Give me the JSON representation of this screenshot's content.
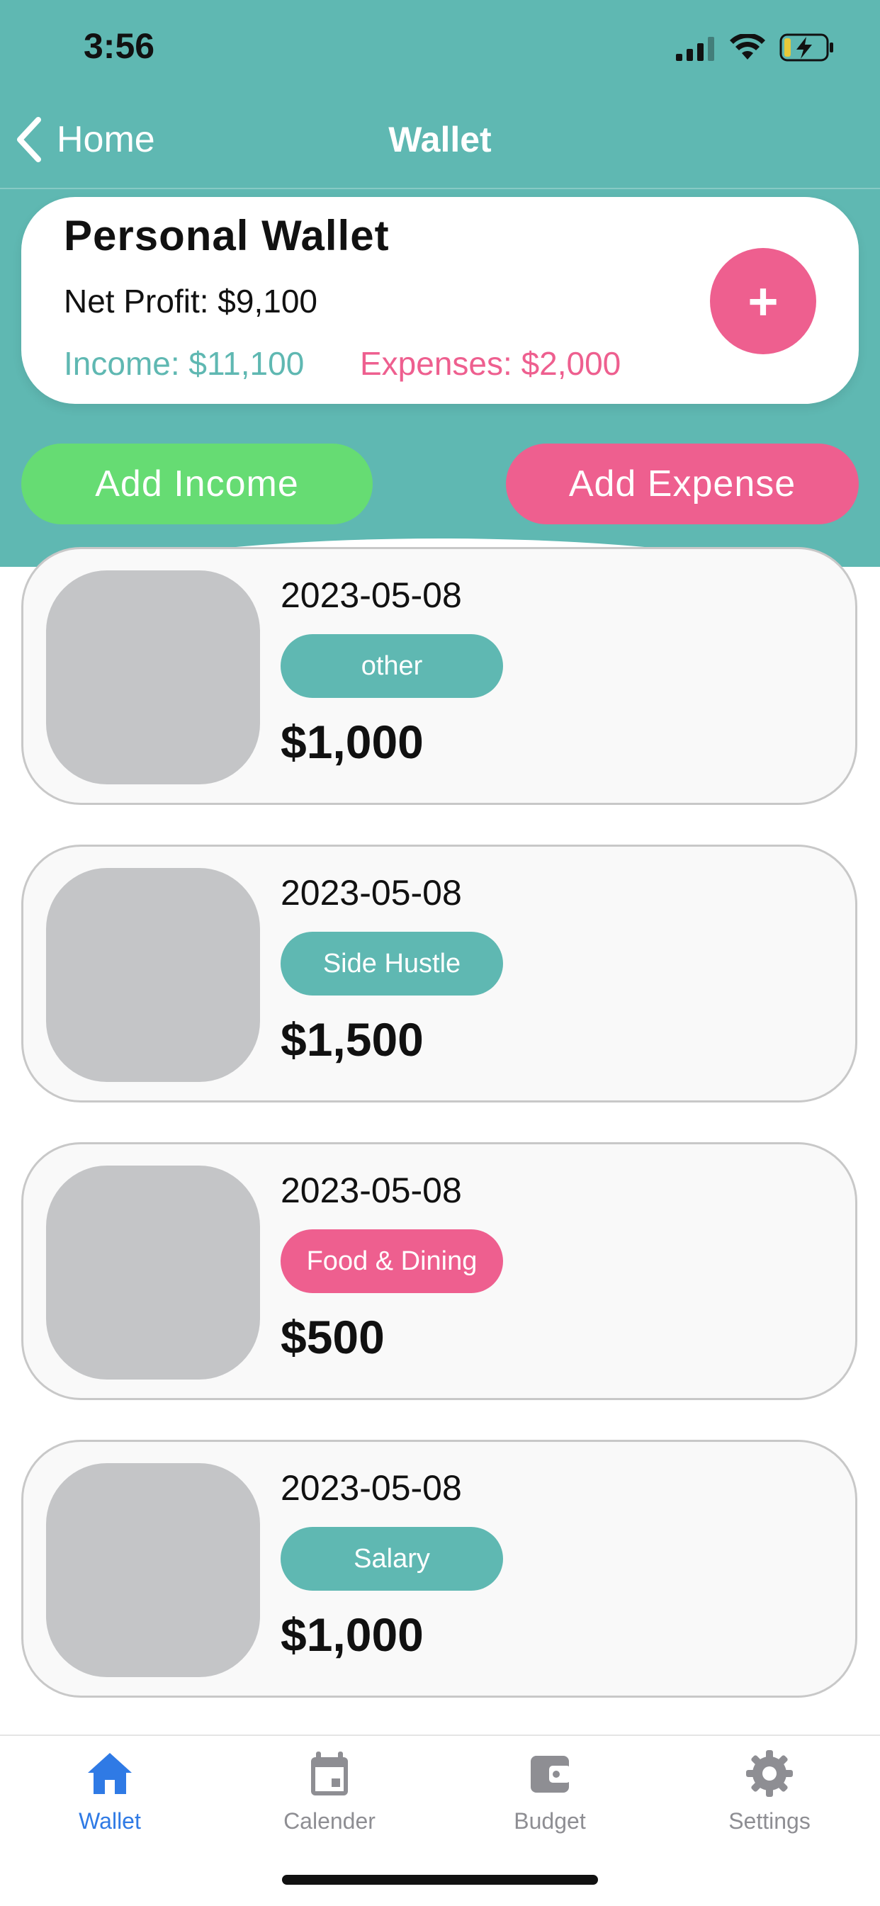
{
  "status_bar": {
    "time": "3:56"
  },
  "nav": {
    "back_label": "Home",
    "title": "Wallet"
  },
  "wallet": {
    "name": "Personal Wallet",
    "net_profit": "Net Profit: $9,100",
    "income": "Income: $11,100",
    "expenses": "Expenses: $2,000",
    "add_symbol": "+"
  },
  "actions": {
    "add_income": "Add Income",
    "add_expense": "Add Expense"
  },
  "entries": [
    {
      "date": "2023-05-08",
      "category": "other",
      "amount": "$1,000",
      "category_color": "#5fb8b2"
    },
    {
      "date": "2023-05-08",
      "category": "Side Hustle",
      "amount": "$1,500",
      "category_color": "#5fb8b2"
    },
    {
      "date": "2023-05-08",
      "category": "Food & Dining",
      "amount": "$500",
      "category_color": "#ee5f8f"
    },
    {
      "date": "2023-05-08",
      "category": "Salary",
      "amount": "$1,000",
      "category_color": "#5fb8b2"
    }
  ],
  "tabs": [
    {
      "label": "Wallet",
      "icon": "home-icon",
      "active": true
    },
    {
      "label": "Calender",
      "icon": "calendar-icon",
      "active": false
    },
    {
      "label": "Budget",
      "icon": "wallet-icon",
      "active": false
    },
    {
      "label": "Settings",
      "icon": "gear-icon",
      "active": false
    }
  ],
  "colors": {
    "teal": "#5fb8b2",
    "pink": "#ee5f8f",
    "green": "#66dc73",
    "active_tab": "#2f7ae5"
  }
}
